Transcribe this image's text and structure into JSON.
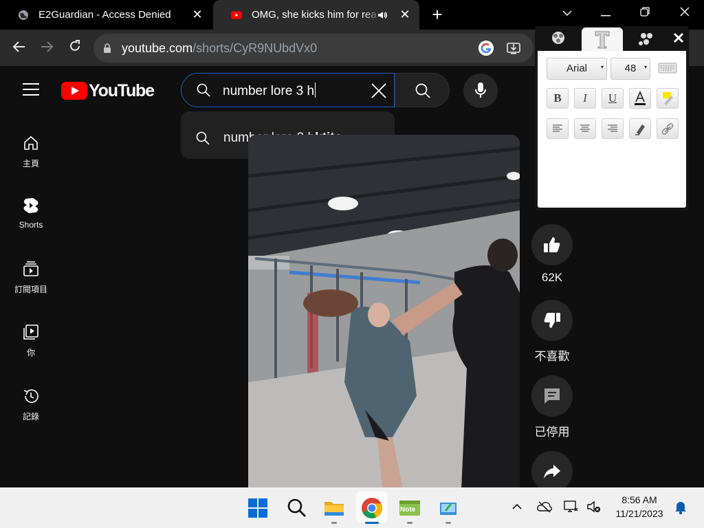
{
  "tabs": [
    {
      "title": "E2Guardian - Access Denied",
      "icon": "globe-icon"
    },
    {
      "title": "OMG,  she kicks him for rea",
      "icon": "youtube-icon",
      "audio_icon": "speaker-icon"
    }
  ],
  "address_bar": {
    "host": "youtube.com",
    "path": "/shorts/CyR9NUbdVx0"
  },
  "youtube": {
    "logo_text": "YouTube",
    "search_value": "number lore 3 h",
    "suggestion_typed": "number lore 3 h",
    "suggestion_completion": "ktito",
    "nav": [
      {
        "label": "主頁",
        "icon": "home-icon"
      },
      {
        "label": "Shorts",
        "icon": "shorts-icon"
      },
      {
        "label": "訂閱項目",
        "icon": "subscriptions-icon"
      },
      {
        "label": "你",
        "icon": "you-icon"
      },
      {
        "label": "記錄",
        "icon": "history-icon"
      }
    ],
    "actions": [
      {
        "label": "62K",
        "icon": "thumbs-up-icon"
      },
      {
        "label": "不喜歡",
        "icon": "thumbs-down-icon"
      },
      {
        "label": "已停用",
        "icon": "comment-icon"
      },
      {
        "label": "",
        "icon": "share-icon"
      }
    ]
  },
  "text_extension": {
    "font": "Arial",
    "size": "48",
    "format_buttons": [
      "B",
      "I",
      "U"
    ]
  },
  "taskbar": {
    "time": "8:56 AM",
    "date": "11/21/2023",
    "note_app_label": "Note"
  },
  "colors": {
    "youtube_red": "#ff0000",
    "search_focus": "#1c62b9",
    "accent_blue": "#0067c0"
  }
}
